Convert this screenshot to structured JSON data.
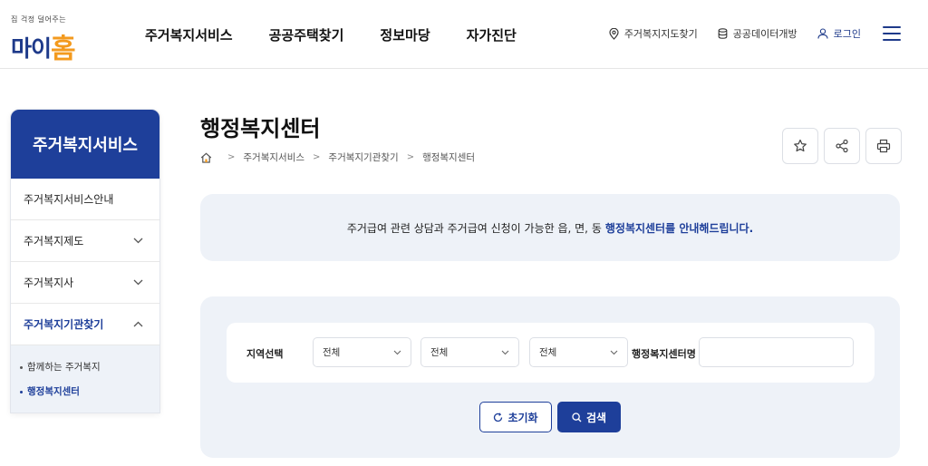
{
  "logo": {
    "tagline": "집 걱정 덜어주는",
    "name_part1": "마이",
    "name_part2": "홈"
  },
  "gnb": [
    {
      "label": "주거복지서비스"
    },
    {
      "label": "공공주택찾기"
    },
    {
      "label": "정보마당"
    },
    {
      "label": "자가진단"
    }
  ],
  "util": {
    "map_label": "주거복지지도찾기",
    "open_data_label": "공공데이터개방",
    "login_label": "로그인"
  },
  "sidebar": {
    "title": "주거복지서비스",
    "items": [
      {
        "label": "주거복지서비스안내"
      },
      {
        "label": "주거복지제도"
      },
      {
        "label": "주거복지사"
      },
      {
        "label": "주거복지기관찾기"
      }
    ],
    "sub_items": [
      {
        "label": "함께하는 주거복지"
      },
      {
        "label": "행정복지센터"
      }
    ]
  },
  "page": {
    "title": "행정복지센터",
    "breadcrumb": [
      "주거복지서비스",
      "주거복지기관찾기",
      "행정복지센터"
    ]
  },
  "notice": {
    "text": "주거급여 관련 상담과 주거급여 신청이 가능한 읍, 면, 동",
    "highlight": "행정복지센터를 안내해드립니다."
  },
  "search": {
    "region_label": "지역선택",
    "selects": [
      {
        "value": "전체"
      },
      {
        "value": "전체"
      },
      {
        "value": "전체"
      }
    ],
    "name_label": "행정복지센터명",
    "name_value": "",
    "reset_label": "초기화",
    "search_label": "검색"
  },
  "colors": {
    "primary": "#1e3f9a",
    "accent": "#f39a1e",
    "panel_bg": "#eef2f8"
  }
}
